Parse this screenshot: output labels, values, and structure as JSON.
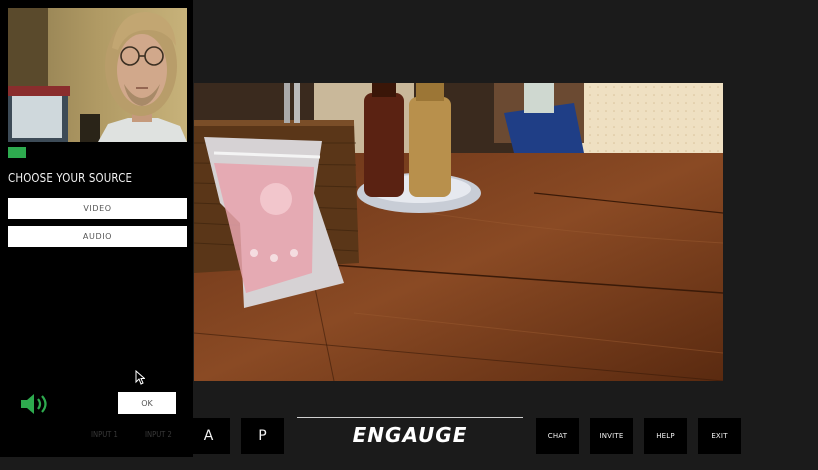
{
  "source_panel": {
    "heading": "CHOOSE YOUR SOURCE",
    "video_label": "VIDEO",
    "audio_label": "AUDIO",
    "ok_label": "OK",
    "audio_active_color": "#2eab4f"
  },
  "toolbar": {
    "input1_label": "INPUT 1",
    "input2_label": "INPUT 2",
    "a_label": "A",
    "p_label": "P",
    "logo_text": "ENGAUGE",
    "chat_label": "CHAT",
    "invite_label": "INVITE",
    "help_label": "HELP",
    "exit_label": "EXIT"
  },
  "icons": {
    "speaker": "speaker-icon",
    "cursor": "cursor-icon"
  }
}
